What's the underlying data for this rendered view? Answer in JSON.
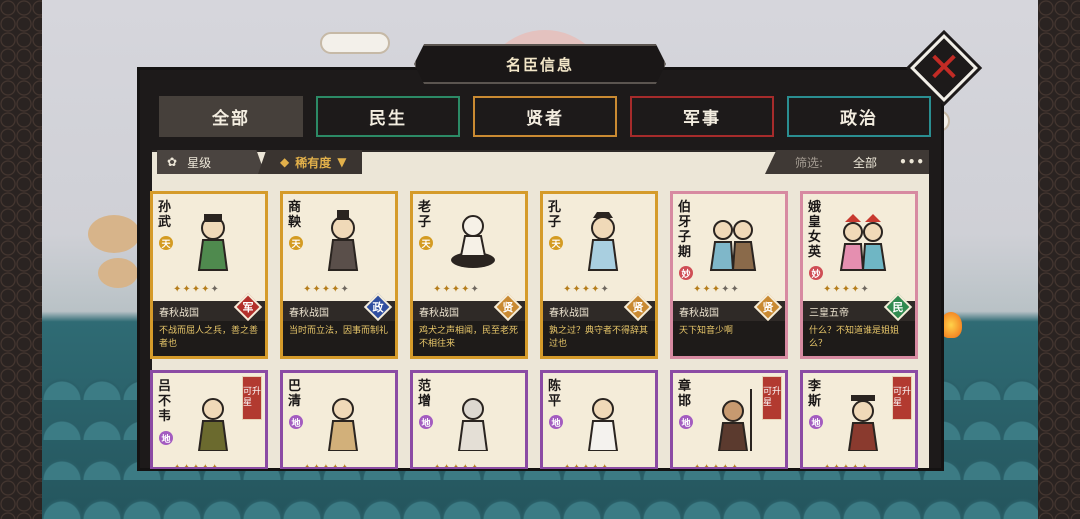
{
  "panel": {
    "title": "名臣信息"
  },
  "tabs": [
    {
      "label": "全部",
      "active": true
    },
    {
      "label": "民生"
    },
    {
      "label": "贤者"
    },
    {
      "label": "军事"
    },
    {
      "label": "政治"
    }
  ],
  "sort": {
    "star_label": "星级",
    "rarity_label": "稀有度"
  },
  "filter": {
    "label": "筛选:",
    "value": "全部",
    "more": "•••"
  },
  "colors": {
    "tian": "#d49b22",
    "miao": "#cf4e55",
    "di": "#a35bc0",
    "jun": "#b3302b",
    "zheng": "#2f4ea0",
    "xian": "#c98a32",
    "min": "#2f8a4f"
  },
  "cards": [
    {
      "name": "孙武",
      "rank": "天",
      "stars": 4,
      "era": "春秋战国",
      "type": "军",
      "quote": "不战而屈人之兵，善之善者也"
    },
    {
      "name": "商鞅",
      "rank": "天",
      "stars": 4,
      "era": "春秋战国",
      "type": "政",
      "quote": "当时而立法，因事而制礼"
    },
    {
      "name": "老子",
      "rank": "天",
      "stars": 4,
      "era": "春秋战国",
      "type": "贤",
      "quote": "鸡犬之声相闻，民至老死不相往来"
    },
    {
      "name": "孔子",
      "rank": "天",
      "stars": 4,
      "era": "春秋战国",
      "type": "贤",
      "quote": "孰之过？典守者不得辞其过也"
    },
    {
      "name": "伯牙子期",
      "rank": "妙",
      "stars": 3,
      "era": "春秋战国",
      "type": "贤",
      "quote": "天下知音少啊"
    },
    {
      "name": "娥皇女英",
      "rank": "妙",
      "stars": 4,
      "era": "三皇五帝",
      "type": "民",
      "quote": "什么？不知道谁是姐姐么？"
    },
    {
      "name": "吕不韦",
      "rank": "地",
      "upgrade": "可升星"
    },
    {
      "name": "巴清",
      "rank": "地"
    },
    {
      "name": "范增",
      "rank": "地"
    },
    {
      "name": "陈平",
      "rank": "地"
    },
    {
      "name": "章邯",
      "rank": "地",
      "upgrade": "可升星"
    },
    {
      "name": "李斯",
      "rank": "地",
      "upgrade": "可升星"
    }
  ]
}
